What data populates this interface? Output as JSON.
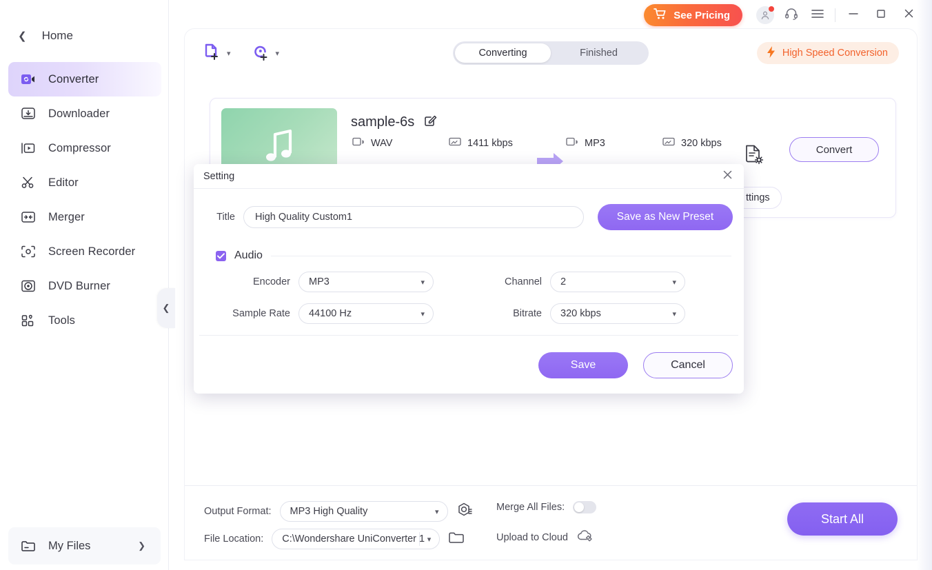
{
  "sidebar": {
    "home": {
      "label": "Home",
      "back_icon": "chevron-left-icon"
    },
    "items": [
      {
        "label": "Converter",
        "icon": "converter-icon",
        "active": true
      },
      {
        "label": "Downloader",
        "icon": "download-icon",
        "active": false
      },
      {
        "label": "Compressor",
        "icon": "compressor-icon",
        "active": false
      },
      {
        "label": "Editor",
        "icon": "scissors-icon",
        "active": false
      },
      {
        "label": "Merger",
        "icon": "merge-icon",
        "active": false
      },
      {
        "label": "Screen Recorder",
        "icon": "record-icon",
        "active": false
      },
      {
        "label": "DVD Burner",
        "icon": "disc-icon",
        "active": false
      },
      {
        "label": "Tools",
        "icon": "grid-icon",
        "active": false
      }
    ],
    "my_files": {
      "label": "My Files",
      "icon": "folder-icon",
      "chevron": "chevron-right-icon"
    }
  },
  "titlebar": {
    "pricing_label": "See Pricing",
    "cart_icon": "cart-icon",
    "account_icon": "user-icon",
    "support_icon": "headset-icon",
    "menu_icon": "hamburger-icon",
    "minimize_icon": "minimize-icon",
    "maximize_icon": "maximize-icon",
    "close_icon": "close-icon",
    "pricing_color": "#f8514f"
  },
  "toolbar": {
    "add_file_icon": "add-file-icon",
    "add_disc_icon": "add-disc-icon",
    "tabs": [
      {
        "label": "Converting",
        "active": true
      },
      {
        "label": "Finished",
        "active": false
      }
    ],
    "high_speed_label": "High Speed Conversion",
    "high_speed_icon": "lightning-icon",
    "high_speed_color": "#f2622c"
  },
  "file_card": {
    "thumbnail_icon": "music-note-icon",
    "name": "sample-6s",
    "edit_icon": "edit-pencil-icon",
    "source": {
      "format": "WAV",
      "format_icon": "video-box-icon",
      "bitrate": "1411 kbps",
      "bitrate_icon": "resolution-icon"
    },
    "target": {
      "format": "MP3",
      "format_icon": "video-box-icon",
      "bitrate": "320 kbps",
      "bitrate_icon": "resolution-icon"
    },
    "arrow_icon": "arrow-right-icon",
    "output_settings_icon": "file-settings-icon",
    "convert_label": "Convert",
    "settings_pill_label": "ttings"
  },
  "bottom_bar": {
    "output_format_label": "Output Format:",
    "output_format_value": "MP3 High Quality",
    "output_format_icon": "output-gear-icon",
    "file_location_label": "File Location:",
    "file_location_value": "C:\\Wondershare UniConverter 1",
    "folder_icon": "folder-open-icon",
    "merge_label": "Merge All Files:",
    "merge_enabled": false,
    "upload_label": "Upload to Cloud",
    "upload_icon": "cloud-upload-icon",
    "start_all_label": "Start All"
  },
  "modal": {
    "title": "Setting",
    "close_icon": "close-icon",
    "title_field_label": "Title",
    "title_field_value": "High Quality Custom1",
    "title_field_placeholder": "Title",
    "save_preset_label": "Save as New Preset",
    "audio_section": {
      "label": "Audio",
      "checked": true,
      "fields": [
        {
          "label": "Encoder",
          "value": "MP3"
        },
        {
          "label": "Channel",
          "value": "2"
        },
        {
          "label": "Sample Rate",
          "value": "44100 Hz"
        },
        {
          "label": "Bitrate",
          "value": "320 kbps"
        }
      ]
    },
    "save_label": "Save",
    "cancel_label": "Cancel",
    "accent_color": "#8f68f2"
  }
}
